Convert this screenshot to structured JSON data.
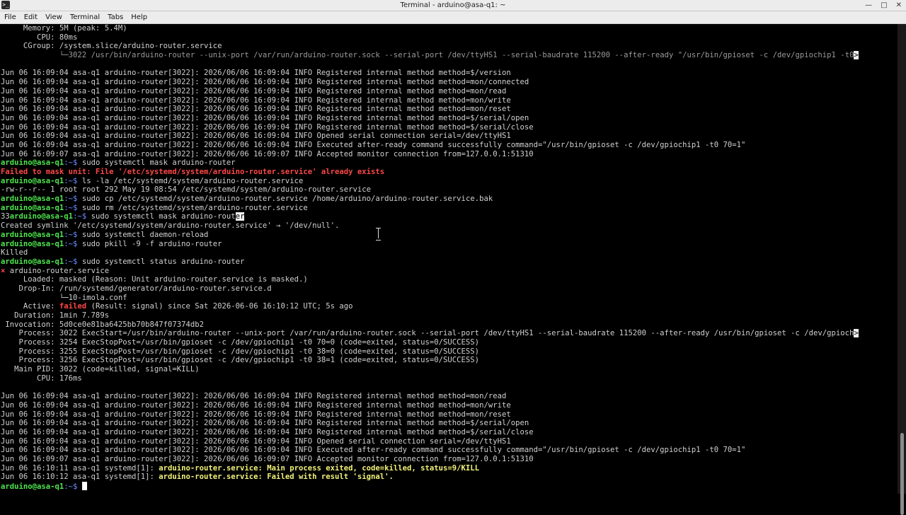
{
  "window": {
    "title": "Terminal - arduino@asa-q1: ~",
    "app_icon": ">_",
    "minimize": "—",
    "maximize": "□",
    "close": "✕"
  },
  "menu": [
    "File",
    "Edit",
    "View",
    "Terminal",
    "Tabs",
    "Help"
  ],
  "prompt": {
    "user": "arduino@asa-q1",
    "sep": ":~$ "
  },
  "cursor_glyph": "er",
  "lines": [
    [
      {
        "t": "     Memory: 5M (peak: 5.4M)"
      }
    ],
    [
      {
        "t": "        CPU: 80ms"
      }
    ],
    [
      {
        "t": "     CGroup: /system.slice/arduino-router.service"
      }
    ],
    [
      {
        "t": "             "
      },
      {
        "t": "└─3022 /usr/bin/arduino-router --unix-port /var/run/arduino-router.sock --serial-port /dev/ttyHS1 --serial-baudrate 115200 --after-ready \"/usr/bin/gpioset -c /dev/gpiochip1 -t0",
        "s": "d"
      },
      {
        "t": ">",
        "s": "trunc"
      }
    ],
    [
      {
        "t": ""
      }
    ],
    [
      {
        "t": "Jun 06 16:09:04 asa-q1 arduino-router[3022]: 2026/06/06 16:09:04 INFO Registered internal method method=$/version"
      }
    ],
    [
      {
        "t": "Jun 06 16:09:04 asa-q1 arduino-router[3022]: 2026/06/06 16:09:04 INFO Registered internal method method=mon/connected"
      }
    ],
    [
      {
        "t": "Jun 06 16:09:04 asa-q1 arduino-router[3022]: 2026/06/06 16:09:04 INFO Registered internal method method=mon/read"
      }
    ],
    [
      {
        "t": "Jun 06 16:09:04 asa-q1 arduino-router[3022]: 2026/06/06 16:09:04 INFO Registered internal method method=mon/write"
      }
    ],
    [
      {
        "t": "Jun 06 16:09:04 asa-q1 arduino-router[3022]: 2026/06/06 16:09:04 INFO Registered internal method method=mon/reset"
      }
    ],
    [
      {
        "t": "Jun 06 16:09:04 asa-q1 arduino-router[3022]: 2026/06/06 16:09:04 INFO Registered internal method method=$/serial/open"
      }
    ],
    [
      {
        "t": "Jun 06 16:09:04 asa-q1 arduino-router[3022]: 2026/06/06 16:09:04 INFO Registered internal method method=$/serial/close"
      }
    ],
    [
      {
        "t": "Jun 06 16:09:04 asa-q1 arduino-router[3022]: 2026/06/06 16:09:04 INFO Opened serial connection serial=/dev/ttyHS1"
      }
    ],
    [
      {
        "t": "Jun 06 16:09:04 asa-q1 arduino-router[3022]: 2026/06/06 16:09:04 INFO Executed after-ready command successfully command=\"/usr/bin/gpioset -c /dev/gpiochip1 -t0 70=1\""
      }
    ],
    [
      {
        "t": "Jun 06 16:09:07 asa-q1 arduino-router[3022]: 2026/06/06 16:09:07 INFO Accepted monitor connection from=127.0.0.1:51310"
      }
    ],
    [
      {
        "t": "arduino@asa-q1",
        "s": "g"
      },
      {
        "t": ":~$ ",
        "s": "b"
      },
      {
        "t": "sudo systemctl mask arduino-router"
      }
    ],
    [
      {
        "t": "Failed to mask unit: File '/etc/systemd/system/arduino-router.service' already exists",
        "s": "r"
      }
    ],
    [
      {
        "t": "arduino@asa-q1",
        "s": "g"
      },
      {
        "t": ":~$ ",
        "s": "b"
      },
      {
        "t": "ls -la /etc/systemd/system/arduino-router.service"
      }
    ],
    [
      {
        "t": "-rw-r--r-- 1 root root 292 May 19 08:54 /etc/systemd/system/arduino-router.service"
      }
    ],
    [
      {
        "t": "arduino@asa-q1",
        "s": "g"
      },
      {
        "t": ":~$ ",
        "s": "b"
      },
      {
        "t": "sudo cp /etc/systemd/system/arduino-router.service /home/arduino/arduino-router.service.bak"
      }
    ],
    [
      {
        "t": "arduino@asa-q1",
        "s": "g"
      },
      {
        "t": ":~$ ",
        "s": "b"
      },
      {
        "t": "sudo rm /etc/systemd/system/arduino-router.service"
      }
    ],
    [
      {
        "t": "33"
      },
      {
        "t": "arduino@asa-q1",
        "s": "g"
      },
      {
        "t": ":~$ ",
        "s": "b"
      },
      {
        "t": "sudo systemctl mask arduino-rout"
      },
      {
        "t": "er",
        "s": "inv"
      }
    ],
    [
      {
        "t": "Created symlink '/etc/systemd/system/arduino-router.service' → '/dev/null'."
      }
    ],
    [
      {
        "t": "arduino@asa-q1",
        "s": "g"
      },
      {
        "t": ":~$ ",
        "s": "b"
      },
      {
        "t": "sudo systemctl daemon-reload"
      }
    ],
    [
      {
        "t": "arduino@asa-q1",
        "s": "g"
      },
      {
        "t": ":~$ ",
        "s": "b"
      },
      {
        "t": "sudo pkill -9 -f arduino-router"
      }
    ],
    [
      {
        "t": "Killed"
      }
    ],
    [
      {
        "t": "arduino@asa-q1",
        "s": "g"
      },
      {
        "t": ":~$ ",
        "s": "b"
      },
      {
        "t": "sudo systemctl status arduino-router"
      }
    ],
    [
      {
        "t": "×",
        "s": "r"
      },
      {
        "t": " arduino-router.service"
      }
    ],
    [
      {
        "t": "     Loaded: masked (Reason: Unit arduino-router.service is masked.)"
      }
    ],
    [
      {
        "t": "    Drop-In: /run/systemd/generator/arduino-router.service.d"
      }
    ],
    [
      {
        "t": "             └─10-imola.conf"
      }
    ],
    [
      {
        "t": "     Active: "
      },
      {
        "t": "failed",
        "s": "r"
      },
      {
        "t": " (Result: signal) since Sat 2026-06-06 16:10:12 UTC; 5s ago"
      }
    ],
    [
      {
        "t": "   Duration: 1min 7.789s"
      }
    ],
    [
      {
        "t": " Invocation: 5d0ce0e81ba6425bb70b847f07374db2"
      }
    ],
    [
      {
        "t": "    Process: 3022 ExecStart=/usr/bin/arduino-router --unix-port /var/run/arduino-router.sock --serial-port /dev/ttyHS1 --serial-baudrate 115200 --after-ready /usr/bin/gpioset -c /dev/gpioch"
      },
      {
        "t": ">",
        "s": "trunc"
      }
    ],
    [
      {
        "t": "    Process: 3254 ExecStopPost=/usr/bin/gpioset -c /dev/gpiochip1 -t0 70=0 (code=exited, status=0/SUCCESS)"
      }
    ],
    [
      {
        "t": "    Process: 3255 ExecStopPost=/usr/bin/gpioset -c /dev/gpiochip1 -t0 38=0 (code=exited, status=0/SUCCESS)"
      }
    ],
    [
      {
        "t": "    Process: 3256 ExecStopPost=/usr/bin/gpioset -c /dev/gpiochip1 -t0 38=1 (code=exited, status=0/SUCCESS)"
      }
    ],
    [
      {
        "t": "   Main PID: 3022 (code=killed, signal=KILL)"
      }
    ],
    [
      {
        "t": "        CPU: 176ms"
      }
    ],
    [
      {
        "t": ""
      }
    ],
    [
      {
        "t": "Jun 06 16:09:04 asa-q1 arduino-router[3022]: 2026/06/06 16:09:04 INFO Registered internal method method=mon/read"
      }
    ],
    [
      {
        "t": "Jun 06 16:09:04 asa-q1 arduino-router[3022]: 2026/06/06 16:09:04 INFO Registered internal method method=mon/write"
      }
    ],
    [
      {
        "t": "Jun 06 16:09:04 asa-q1 arduino-router[3022]: 2026/06/06 16:09:04 INFO Registered internal method method=mon/reset"
      }
    ],
    [
      {
        "t": "Jun 06 16:09:04 asa-q1 arduino-router[3022]: 2026/06/06 16:09:04 INFO Registered internal method method=$/serial/open"
      }
    ],
    [
      {
        "t": "Jun 06 16:09:04 asa-q1 arduino-router[3022]: 2026/06/06 16:09:04 INFO Registered internal method method=$/serial/close"
      }
    ],
    [
      {
        "t": "Jun 06 16:09:04 asa-q1 arduino-router[3022]: 2026/06/06 16:09:04 INFO Opened serial connection serial=/dev/ttyHS1"
      }
    ],
    [
      {
        "t": "Jun 06 16:09:04 asa-q1 arduino-router[3022]: 2026/06/06 16:09:04 INFO Executed after-ready command successfully command=\"/usr/bin/gpioset -c /dev/gpiochip1 -t0 70=1\""
      }
    ],
    [
      {
        "t": "Jun 06 16:09:07 asa-q1 arduino-router[3022]: 2026/06/06 16:09:07 INFO Accepted monitor connection from=127.0.0.1:51310"
      }
    ],
    [
      {
        "t": "Jun 06 16:10:11 asa-q1 systemd[1]: "
      },
      {
        "t": "arduino-router.service: Main process exited, code=killed, status=9/KILL",
        "s": "y"
      }
    ],
    [
      {
        "t": "Jun 06 16:10:12 asa-q1 systemd[1]: "
      },
      {
        "t": "arduino-router.service: Failed with result 'signal'.",
        "s": "y"
      }
    ]
  ]
}
